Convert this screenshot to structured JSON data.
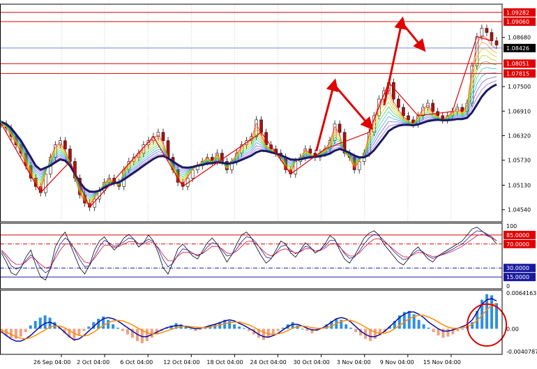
{
  "chart_data": [
    {
      "type": "line",
      "panel": "price",
      "y_ticks": [
        "1.08680",
        "1.07500",
        "1.06910",
        "1.06320",
        "1.05730",
        "1.05130",
        "1.04540"
      ],
      "y_values": [
        1.0868,
        1.075,
        1.0691,
        1.0632,
        1.0573,
        1.0513,
        1.0454
      ],
      "ylim": [
        1.0425,
        1.0948
      ],
      "h_levels": [
        {
          "label": "1.09282",
          "value": 1.09282,
          "color": "#e00000"
        },
        {
          "label": "1.09060",
          "value": 1.0906,
          "color": "#e00000"
        },
        {
          "label": "1.08051",
          "value": 1.08051,
          "color": "#e00000"
        },
        {
          "label": "1.07815",
          "value": 1.07815,
          "color": "#e00000"
        }
      ],
      "current_price": {
        "label": "1.08426",
        "value": 1.08426
      },
      "x_ticks": [
        "26 Sep 04:00",
        "2 Oct 04:00",
        "6 Oct 04:00",
        "12 Oct 04:00",
        "18 Oct 04:00",
        "24 Oct 04:00",
        "30 Oct 04:00",
        "3 Nov 04:00",
        "9 Nov 04:00",
        "15 Nov 04:00"
      ],
      "x_tick_positions": [
        0,
        0.09,
        0.18,
        0.27,
        0.36,
        0.45,
        0.54,
        0.63,
        0.72,
        0.81
      ],
      "close_series": [
        1.066,
        1.065,
        1.063,
        1.061,
        1.059,
        1.056,
        1.053,
        1.051,
        1.0495,
        1.054,
        1.058,
        1.061,
        1.062,
        1.06,
        1.057,
        1.053,
        1.049,
        1.047,
        1.046,
        1.048,
        1.05,
        1.052,
        1.053,
        1.052,
        1.051,
        1.055,
        1.057,
        1.058,
        1.059,
        1.061,
        1.062,
        1.063,
        1.064,
        1.062,
        1.058,
        1.055,
        1.052,
        1.051,
        1.053,
        1.055,
        1.056,
        1.057,
        1.058,
        1.057,
        1.059,
        1.057,
        1.055,
        1.057,
        1.059,
        1.061,
        1.062,
        1.063,
        1.067,
        1.064,
        1.061,
        1.06,
        1.059,
        1.058,
        1.055,
        1.054,
        1.057,
        1.058,
        1.06,
        1.059,
        1.058,
        1.059,
        1.06,
        1.062,
        1.066,
        1.064,
        1.059,
        1.058,
        1.055,
        1.057,
        1.059,
        1.064,
        1.068,
        1.072,
        1.074,
        1.076,
        1.072,
        1.07,
        1.068,
        1.067,
        1.066,
        1.068,
        1.07,
        1.071,
        1.069,
        1.068,
        1.067,
        1.068,
        1.069,
        1.07,
        1.069,
        1.071,
        1.08,
        1.087,
        1.089,
        1.088,
        1.086,
        1.085
      ],
      "ribbon_ma_series": [
        1.0665,
        1.066,
        1.065,
        1.0635,
        1.062,
        1.06,
        1.058,
        1.056,
        1.055,
        1.0555,
        1.056,
        1.0568,
        1.0575,
        1.0572,
        1.056,
        1.054,
        1.052,
        1.0505,
        1.0498,
        1.0497,
        1.05,
        1.0507,
        1.0513,
        1.0518,
        1.052,
        1.0527,
        1.0535,
        1.0543,
        1.0551,
        1.056,
        1.0568,
        1.0576,
        1.0582,
        1.0583,
        1.0578,
        1.057,
        1.0562,
        1.0556,
        1.0555,
        1.0557,
        1.056,
        1.0562,
        1.0565,
        1.0566,
        1.0568,
        1.0567,
        1.0565,
        1.0566,
        1.0569,
        1.0574,
        1.0579,
        1.0584,
        1.0592,
        1.0596,
        1.0595,
        1.0592,
        1.0589,
        1.0585,
        1.058,
        1.0575,
        1.0574,
        1.0575,
        1.0578,
        1.058,
        1.0581,
        1.0583,
        1.0585,
        1.0589,
        1.0596,
        1.06,
        1.0596,
        1.0591,
        1.0584,
        1.058,
        1.058,
        1.0586,
        1.0597,
        1.0612,
        1.0627,
        1.0643,
        1.0651,
        1.0656,
        1.0658,
        1.0658,
        1.0657,
        1.0659,
        1.0663,
        1.0667,
        1.0669,
        1.067,
        1.0669,
        1.0669,
        1.067,
        1.0672,
        1.0672,
        1.0675,
        1.0688,
        1.0707,
        1.0726,
        1.074,
        1.0749,
        1.0755
      ]
    },
    {
      "type": "line",
      "panel": "stochastic",
      "y_ticks": [
        "100",
        "85.0000",
        "70.0000",
        "30.0000",
        "15.0000",
        "0"
      ],
      "levels": [
        {
          "label": "85.0000",
          "value": 85,
          "color": "#e00000",
          "style": "solid"
        },
        {
          "label": "70.0000",
          "value": 70,
          "color": "#e00000",
          "style": "dashdot"
        },
        {
          "label": "30.0000",
          "value": 30,
          "color": "#1a1aa0",
          "style": "dashdot"
        },
        {
          "label": "15.0000",
          "value": 15,
          "color": "#1a1aa0",
          "style": "solid"
        }
      ],
      "ylim": [
        0,
        100
      ],
      "series": [
        {
          "color": "#000000",
          "values": [
            55,
            40,
            22,
            18,
            30,
            48,
            60,
            35,
            15,
            10,
            30,
            65,
            80,
            90,
            70,
            50,
            30,
            20,
            35,
            60,
            75,
            82,
            70,
            60,
            68,
            80,
            86,
            78,
            65,
            72,
            85,
            75,
            55,
            30,
            20,
            40,
            62,
            70,
            60,
            50,
            45,
            58,
            72,
            80,
            70,
            55,
            40,
            52,
            70,
            85,
            90,
            80,
            65,
            50,
            38,
            45,
            60,
            75,
            70,
            55,
            48,
            60,
            72,
            65,
            55,
            60,
            70,
            84,
            78,
            60,
            45,
            38,
            50,
            65,
            80,
            88,
            92,
            85,
            70,
            60,
            50,
            40,
            35,
            45,
            58,
            65,
            55,
            45,
            40,
            50,
            55,
            60,
            65,
            70,
            75,
            85,
            95,
            98,
            92,
            85,
            80,
            70
          ]
        },
        {
          "color": "#1a1aa0",
          "values": [
            58,
            48,
            34,
            28,
            32,
            42,
            52,
            44,
            30,
            22,
            28,
            52,
            70,
            80,
            74,
            60,
            44,
            32,
            34,
            50,
            66,
            76,
            72,
            66,
            68,
            74,
            80,
            78,
            70,
            72,
            78,
            74,
            62,
            44,
            32,
            38,
            52,
            62,
            60,
            55,
            50,
            55,
            65,
            72,
            70,
            60,
            50,
            52,
            62,
            74,
            82,
            80,
            72,
            60,
            48,
            46,
            55,
            66,
            68,
            60,
            54,
            58,
            66,
            64,
            58,
            60,
            66,
            76,
            76,
            66,
            54,
            46,
            48,
            58,
            70,
            80,
            86,
            84,
            76,
            68,
            58,
            50,
            44,
            46,
            54,
            60,
            57,
            50,
            46,
            49,
            53,
            57,
            61,
            66,
            70,
            78,
            86,
            92,
            91,
            87,
            82,
            75
          ]
        },
        {
          "color": "#d01030",
          "values": [
            60,
            52,
            42,
            36,
            36,
            40,
            48,
            44,
            36,
            30,
            32,
            46,
            60,
            70,
            70,
            62,
            50,
            40,
            38,
            46,
            58,
            68,
            68,
            64,
            66,
            70,
            74,
            74,
            70,
            70,
            74,
            72,
            64,
            52,
            42,
            42,
            50,
            56,
            56,
            54,
            52,
            54,
            60,
            66,
            66,
            62,
            55,
            54,
            58,
            66,
            74,
            75,
            70,
            62,
            54,
            50,
            54,
            60,
            62,
            58,
            55,
            57,
            62,
            62,
            58,
            59,
            63,
            70,
            71,
            65,
            56,
            50,
            50,
            55,
            64,
            72,
            78,
            79,
            74,
            68,
            61,
            54,
            49,
            48,
            52,
            56,
            55,
            52,
            49,
            50,
            52,
            55,
            58,
            62,
            66,
            72,
            78,
            84,
            86,
            84,
            80,
            76
          ]
        }
      ]
    },
    {
      "type": "bar",
      "panel": "macd",
      "y_ticks": [
        "0.0064163",
        "0.00",
        "-0.0040787"
      ],
      "ylim": [
        -0.0040787,
        0.0064163
      ],
      "histogram": [
        -0.0008,
        -0.0012,
        -0.0016,
        -0.0018,
        -0.0014,
        -0.0006,
        0.0006,
        0.0014,
        0.002,
        0.0024,
        0.002,
        0.0012,
        0.0002,
        -0.0008,
        -0.0016,
        -0.002,
        -0.0012,
        -0.0004,
        0.0004,
        0.0012,
        0.0018,
        0.0022,
        0.0016,
        0.0008,
        0.0002,
        -0.0004,
        -0.001,
        -0.0016,
        -0.0022,
        -0.0026,
        -0.0022,
        -0.0016,
        -0.001,
        -0.0004,
        0.0002,
        0.0006,
        0.001,
        0.0008,
        0.0004,
        0.0,
        -0.0004,
        -0.0002,
        0.0002,
        0.0006,
        0.0008,
        0.0012,
        0.0016,
        0.0014,
        0.0008,
        0.0004,
        0.0001,
        -0.0004,
        -0.001,
        -0.0016,
        -0.002,
        -0.0016,
        -0.001,
        -0.0004,
        0.0002,
        0.0008,
        0.0012,
        0.0006,
        0.0,
        -0.0004,
        -0.0008,
        -0.0004,
        0.0002,
        0.0008,
        0.0014,
        0.0018,
        0.0016,
        0.0008,
        0.0002,
        -0.0006,
        -0.0012,
        -0.0018,
        -0.0022,
        -0.0018,
        -0.0012,
        -0.0006,
        0.0004,
        0.0014,
        0.0024,
        0.003,
        0.0032,
        0.0026,
        0.0016,
        0.0008,
        0.0002,
        -0.0006,
        -0.0012,
        -0.0016,
        -0.0014,
        -0.001,
        -0.0004,
        0.0,
        0.0004,
        0.0012,
        0.0032,
        0.0052,
        0.0062,
        0.006,
        0.0046
      ],
      "series": [
        {
          "color": "#0a0aa0",
          "values": [
            -0.0005,
            -0.0012,
            -0.0018,
            -0.0022,
            -0.0022,
            -0.0018,
            -0.0012,
            -0.0004,
            0.0004,
            0.001,
            0.0012,
            0.0008,
            0.0002,
            -0.0006,
            -0.0014,
            -0.002,
            -0.0018,
            -0.0012,
            -0.0004,
            0.0004,
            0.0012,
            0.0018,
            0.002,
            0.0018,
            0.0014,
            0.0008,
            0.0002,
            -0.0004,
            -0.001,
            -0.0014,
            -0.0014,
            -0.001,
            -0.0006,
            -0.0002,
            0.0002,
            0.0004,
            0.0006,
            0.0006,
            0.0004,
            0.0002,
            0.0,
            0.0001,
            0.0003,
            0.0006,
            0.0008,
            0.0011,
            0.0014,
            0.0016,
            0.0014,
            0.001,
            0.0006,
            0.0001,
            -0.0004,
            -0.001,
            -0.0014,
            -0.0015,
            -0.0012,
            -0.0008,
            -0.0002,
            0.0004,
            0.0008,
            0.0008,
            0.0005,
            0.0001,
            -0.0002,
            -0.0002,
            0.0001,
            0.0006,
            0.0012,
            0.0018,
            0.002,
            0.0018,
            0.0012,
            0.0004,
            -0.0004,
            -0.001,
            -0.0014,
            -0.0014,
            -0.001,
            -0.0004,
            0.0004,
            0.0012,
            0.002,
            0.0026,
            0.003,
            0.003,
            0.0026,
            0.002,
            0.0012,
            0.0006,
            0.0,
            -0.0004,
            -0.0004,
            -0.0002,
            0.0001,
            0.0004,
            0.0008,
            0.0016,
            0.003,
            0.0044,
            0.0052,
            0.0054,
            0.005
          ]
        },
        {
          "color": "#ff8c00",
          "values": [
            -0.0002,
            -0.0006,
            -0.001,
            -0.0014,
            -0.0017,
            -0.0018,
            -0.0016,
            -0.0012,
            -0.0007,
            -0.0002,
            0.0003,
            0.0005,
            0.0005,
            0.0002,
            -0.0003,
            -0.0008,
            -0.0012,
            -0.0013,
            -0.0011,
            -0.0006,
            0.0,
            0.0006,
            0.0011,
            0.0014,
            0.0015,
            0.0014,
            0.0011,
            0.0007,
            0.0002,
            -0.0003,
            -0.0007,
            -0.0009,
            -0.0009,
            -0.0007,
            -0.0004,
            -0.0001,
            0.0002,
            0.0004,
            0.0005,
            0.0004,
            0.0003,
            0.0002,
            0.0002,
            0.0003,
            0.0005,
            0.0007,
            0.0009,
            0.0011,
            0.0012,
            0.0012,
            0.001,
            0.0007,
            0.0003,
            -0.0002,
            -0.0006,
            -0.0009,
            -0.001,
            -0.0009,
            -0.0007,
            -0.0003,
            0.0001,
            0.0004,
            0.0005,
            0.0004,
            0.0002,
            0.0001,
            0.0001,
            0.0002,
            0.0005,
            0.0009,
            0.0013,
            0.0015,
            0.0015,
            0.0012,
            0.0008,
            0.0003,
            -0.0002,
            -0.0006,
            -0.0008,
            -0.0008,
            -0.0005,
            0.0,
            0.0006,
            0.0012,
            0.0018,
            0.0022,
            0.0024,
            0.0024,
            0.0021,
            0.0017,
            0.0012,
            0.0007,
            0.0003,
            0.0001,
            0.0001,
            0.0002,
            0.0004,
            0.0008,
            0.0015,
            0.0024,
            0.0034,
            0.0042,
            0.0046
          ]
        }
      ],
      "annotation": {
        "shape": "circle",
        "color": "#e00000"
      }
    }
  ],
  "arrows": [
    {
      "from": [
        0.63,
        1.0595
      ],
      "to": [
        0.665,
        1.0755
      ],
      "color": "#e00000"
    },
    {
      "from": [
        0.665,
        1.0755
      ],
      "to": [
        0.735,
        1.0657
      ],
      "color": "#e00000"
    },
    {
      "from": [
        0.765,
        1.0705
      ],
      "to": [
        0.8,
        1.0904
      ],
      "color": "#e00000"
    },
    {
      "from": [
        0.8,
        1.0904
      ],
      "to": [
        0.84,
        1.0845
      ],
      "color": "#e00000"
    }
  ]
}
